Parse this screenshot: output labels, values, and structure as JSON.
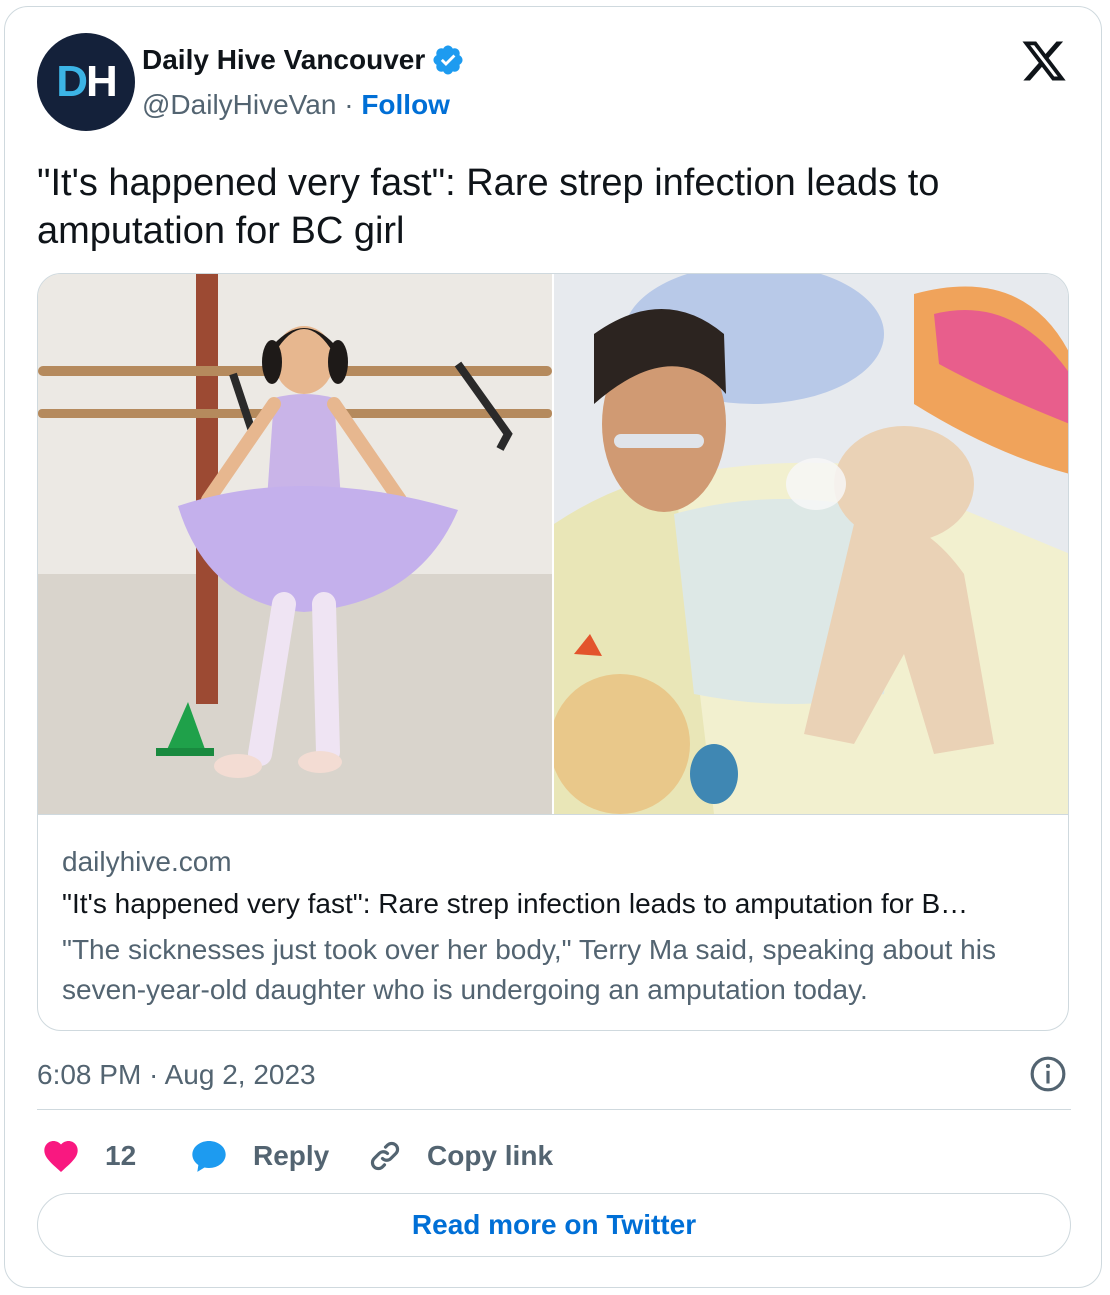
{
  "author": {
    "avatar_initials_d": "D",
    "avatar_initials_h": "H",
    "name": "Daily Hive Vancouver",
    "handle": "@DailyHiveVan",
    "separator": " · ",
    "follow_label": "Follow"
  },
  "tweet": {
    "text": "\"It's happened very fast\": Rare strep infection leads to amputation for BC girl"
  },
  "link_card": {
    "domain": "dailyhive.com",
    "title": "\"It's happened very fast\": Rare strep infection leads to amputation for B…",
    "description": "\"The sicknesses just took over her body,\" Terry Ma said, speaking about his seven-year-old daughter who is undergoing an amputation today."
  },
  "meta": {
    "timestamp": "6:08 PM · Aug 2, 2023"
  },
  "actions": {
    "like_count": "12",
    "reply_label": "Reply",
    "copy_link_label": "Copy link"
  },
  "read_more_label": "Read more on Twitter",
  "colors": {
    "link_blue": "#006fd6",
    "secondary_text": "#536471",
    "heart_pink": "#f91880",
    "reply_blue": "#1d9bf0",
    "verified_blue": "#1d9bf0",
    "border": "#cfd9de",
    "avatar_bg": "#14213a"
  },
  "icons": {
    "verified": "verified-badge-icon",
    "x_logo": "x-logo-icon",
    "info": "info-icon",
    "like": "heart-icon",
    "reply": "speech-bubble-icon",
    "copy_link": "link-icon"
  }
}
